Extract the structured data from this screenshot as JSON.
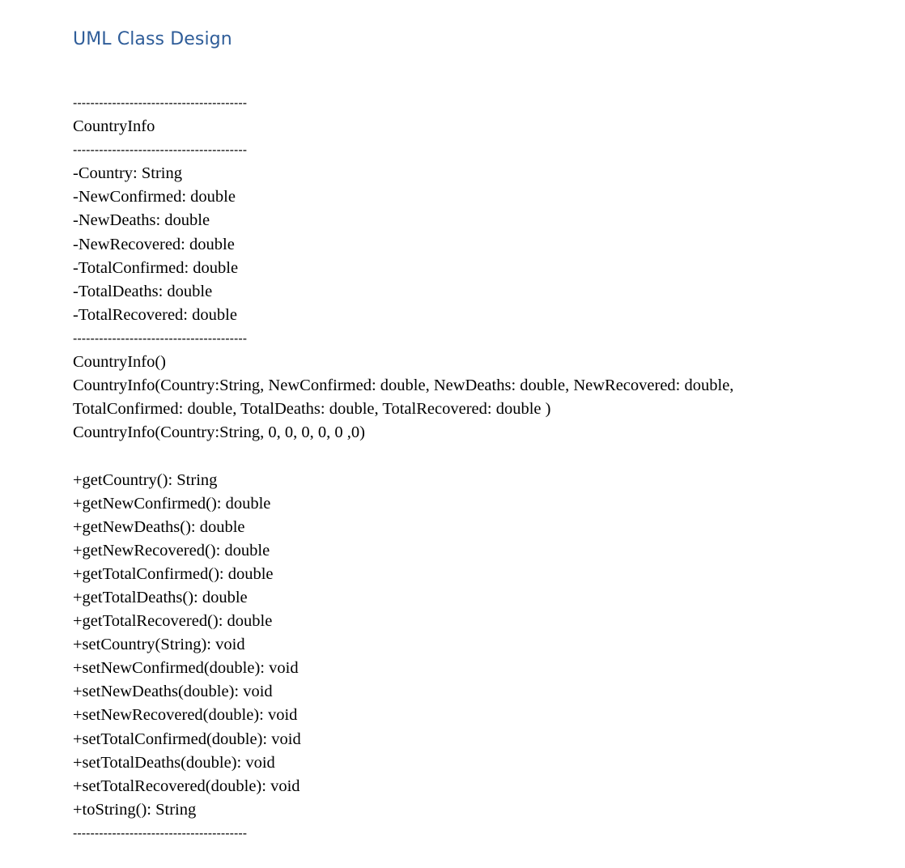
{
  "heading": "UML Class Design",
  "uml": {
    "divider": "----------------------------------------",
    "class_name": "CountryInfo",
    "attributes": [
      "-Country: String",
      "-NewConfirmed: double",
      "-NewDeaths: double",
      "-NewRecovered: double",
      "-TotalConfirmed: double",
      "-TotalDeaths: double",
      "-TotalRecovered: double"
    ],
    "constructors": [
      "CountryInfo()",
      "CountryInfo(Country:String, NewConfirmed: double, NewDeaths: double, NewRecovered: double,",
      "TotalConfirmed: double, TotalDeaths: double, TotalRecovered: double )",
      "CountryInfo(Country:String, 0, 0, 0, 0, 0 ,0)"
    ],
    "methods": [
      "+getCountry(): String",
      "+getNewConfirmed(): double",
      "+getNewDeaths(): double",
      "+getNewRecovered(): double",
      "+getTotalConfirmed(): double",
      "+getTotalDeaths(): double",
      "+getTotalRecovered(): double",
      "+setCountry(String): void",
      "+setNewConfirmed(double): void",
      "+setNewDeaths(double): void",
      "+setNewRecovered(double): void",
      "+setTotalConfirmed(double): void",
      "+setTotalDeaths(double): void",
      "+setTotalRecovered(double): void",
      "+toString(): String"
    ]
  }
}
